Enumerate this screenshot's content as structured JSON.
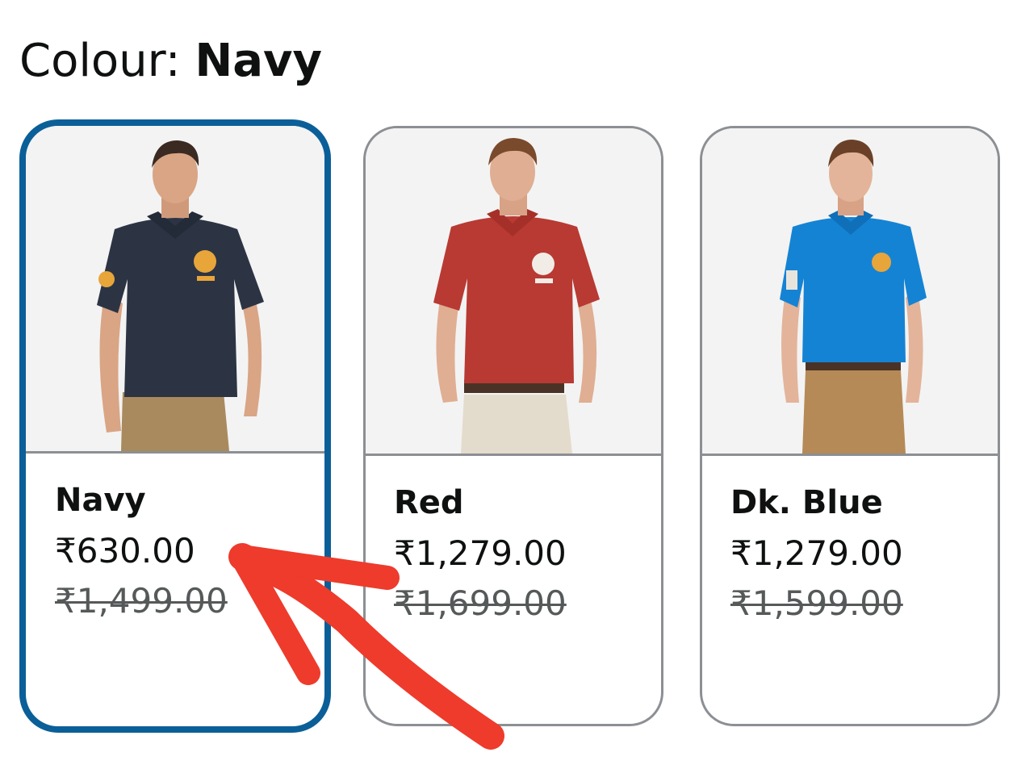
{
  "colour": {
    "label": "Colour: ",
    "selected": "Navy"
  },
  "swatches": [
    {
      "name": "Navy",
      "price": "₹630.00",
      "mrp": "₹1,499.00",
      "selected": true,
      "shirt_color": "#2c3444",
      "pants_color": "#a98a5e",
      "logo_color": "#e8a53a"
    },
    {
      "name": "Red",
      "price": "₹1,279.00",
      "mrp": "₹1,699.00",
      "selected": false,
      "shirt_color": "#b83a33",
      "pants_color": "#e3dccd",
      "logo_color": "#f2ece6"
    },
    {
      "name": "Dk. Blue",
      "price": "₹1,279.00",
      "mrp": "₹1,599.00",
      "selected": false,
      "shirt_color": "#1583d4",
      "pants_color": "#b58a56",
      "logo_color": "#e8a53a"
    }
  ],
  "colors": {
    "selected_border": "#0b5f98",
    "default_border": "#8c8f93",
    "annotation_arrow": "#ee3b2c"
  },
  "icons": {
    "annotation": "red-arrow-pointing-up-left"
  }
}
